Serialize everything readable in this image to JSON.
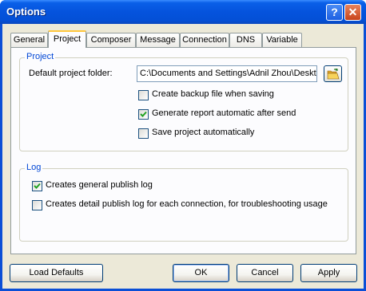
{
  "window": {
    "title": "Options",
    "help_glyph": "?",
    "close_glyph": "✕"
  },
  "tabs": [
    {
      "label": "General",
      "active": false
    },
    {
      "label": "Project",
      "active": true
    },
    {
      "label": "Composer",
      "active": false
    },
    {
      "label": "Message",
      "active": false
    },
    {
      "label": "Connection",
      "active": false
    },
    {
      "label": "DNS",
      "active": false
    },
    {
      "label": "Variable",
      "active": false
    }
  ],
  "project_group": {
    "legend": "Project",
    "folder_label": "Default project folder:",
    "folder_value": "C:\\Documents and Settings\\Adnil Zhou\\Deskt",
    "options": [
      {
        "label": "Create backup file when saving",
        "checked": false
      },
      {
        "label": "Generate report automatic after send",
        "checked": true
      },
      {
        "label": "Save project automatically",
        "checked": false
      }
    ]
  },
  "log_group": {
    "legend": "Log",
    "options": [
      {
        "label": "Creates general publish log",
        "checked": true
      },
      {
        "label": "Creates detail publish log for each connection, for troubleshooting usage",
        "checked": false
      }
    ]
  },
  "buttons": {
    "load_defaults": "Load Defaults",
    "ok": "OK",
    "cancel": "Cancel",
    "apply": "Apply"
  },
  "colors": {
    "titlebar": "#0553dd",
    "dialog_bg": "#ece9d8",
    "group_legend": "#0046d5",
    "active_tab_accent": "#ffc73c"
  }
}
